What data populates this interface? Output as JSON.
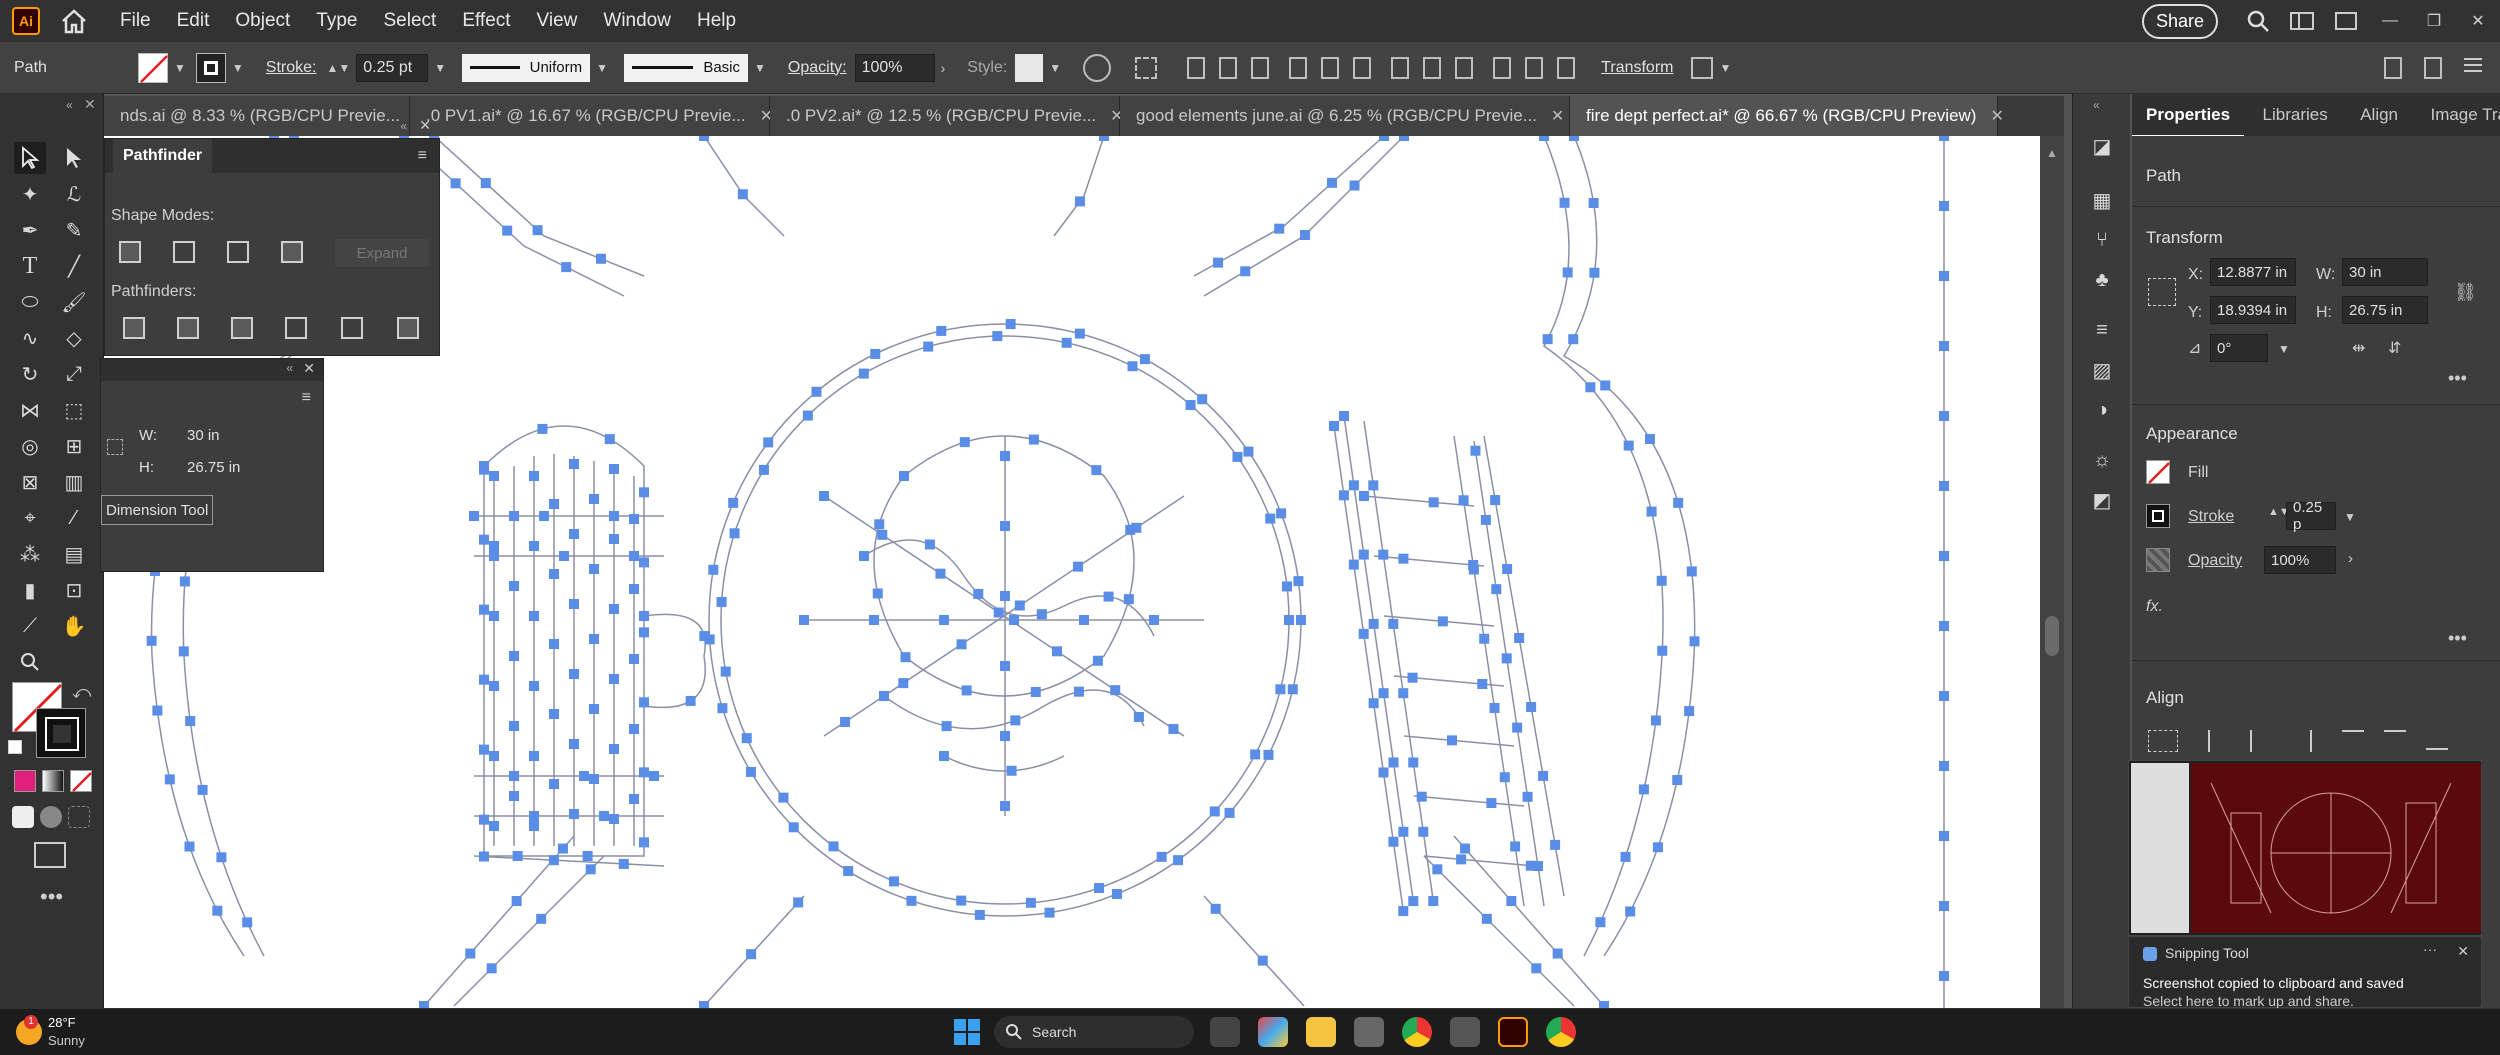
{
  "app": {
    "logo_text": "Ai",
    "menu": [
      "File",
      "Edit",
      "Object",
      "Type",
      "Select",
      "Effect",
      "View",
      "Window",
      "Help"
    ],
    "share_label": "Share",
    "accent": "#ff9a00"
  },
  "control_bar": {
    "selection_type": "Path",
    "stroke_label": "Stroke:",
    "stroke_value": "0.25 pt",
    "profile_uniform": "Uniform",
    "brush_basic": "Basic",
    "opacity_label": "Opacity:",
    "opacity_value": "100%",
    "style_label": "Style:",
    "transform_link": "Transform"
  },
  "tabs": [
    {
      "label": "nds.ai @ 8.33 % (RGB/CPU Previe...",
      "active": false
    },
    {
      "label": ".0 PV1.ai* @ 16.67 % (RGB/CPU Previe...",
      "active": false
    },
    {
      "label": ".0 PV2.ai* @ 12.5 % (RGB/CPU Previe...",
      "active": false
    },
    {
      "label": "good elements june.ai @ 6.25 % (RGB/CPU Previe...",
      "active": false
    },
    {
      "label": "fire dept perfect.ai* @ 66.67 % (RGB/CPU Preview)",
      "active": true
    }
  ],
  "pathfinder": {
    "title": "Pathfinder",
    "shape_modes": "Shape Modes:",
    "pathfinders": "Pathfinders:",
    "expand": "Expand"
  },
  "transform_mini": {
    "w_label": "W:",
    "w_value": "30 in",
    "h_label": "H:",
    "h_value": "26.75 in",
    "tooltip": "Dimension Tool"
  },
  "properties": {
    "tabs": [
      "Properties",
      "Libraries",
      "Align",
      "Image Tra"
    ],
    "object_type": "Path",
    "transform_title": "Transform",
    "x_label": "X:",
    "x_value": "12.8877 in",
    "y_label": "Y:",
    "y_value": "18.9394 in",
    "w_label": "W:",
    "w_value": "30 in",
    "h_label": "H:",
    "h_value": "26.75 in",
    "angle_value": "0°",
    "appearance_title": "Appearance",
    "fill_label": "Fill",
    "stroke_label": "Stroke",
    "stroke_value": "0.25 p",
    "opacity_label": "Opacity",
    "opacity_value": "100%",
    "fx_label": "fx.",
    "align_title": "Align"
  },
  "snip": {
    "app_name": "Snipping Tool",
    "message_title": "Screenshot copied to clipboard and saved",
    "message_body": "Select here to mark up and share."
  },
  "taskbar": {
    "weather_temp": "28°F",
    "weather_desc": "Sunny",
    "weather_badge": "1",
    "search_label": "Search"
  }
}
